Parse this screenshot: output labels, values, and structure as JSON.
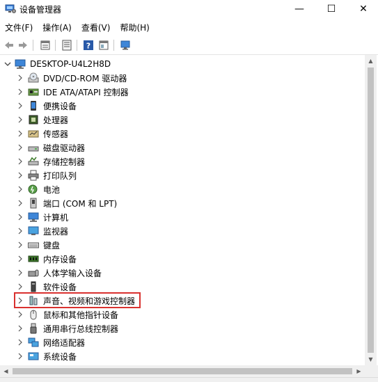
{
  "window": {
    "title": "设备管理器",
    "minimize_glyph": "—",
    "maximize_glyph": "☐",
    "close_glyph": "✕"
  },
  "menu": [
    {
      "label": "文件(F)"
    },
    {
      "label": "操作(A)"
    },
    {
      "label": "查看(V)"
    },
    {
      "label": "帮助(H)"
    }
  ],
  "toolbar": {
    "buttons": [
      "back-arrow-icon",
      "forward-arrow-icon",
      "properties-icon",
      "device-list-icon",
      "help-icon",
      "update-driver-icon",
      "monitor-scan-icon"
    ]
  },
  "tree": {
    "root": {
      "label": "DESKTOP-U4L2H8D",
      "icon": "computer-icon",
      "expanded": true
    },
    "items": [
      {
        "label": "DVD/CD-ROM 驱动器",
        "icon": "dvd-drive-icon"
      },
      {
        "label": "IDE ATA/ATAPI 控制器",
        "icon": "ide-controller-icon"
      },
      {
        "label": "便携设备",
        "icon": "portable-device-icon"
      },
      {
        "label": "处理器",
        "icon": "processor-icon"
      },
      {
        "label": "传感器",
        "icon": "sensor-icon"
      },
      {
        "label": "磁盘驱动器",
        "icon": "disk-drive-icon"
      },
      {
        "label": "存储控制器",
        "icon": "storage-controller-icon"
      },
      {
        "label": "打印队列",
        "icon": "printer-icon"
      },
      {
        "label": "电池",
        "icon": "battery-icon"
      },
      {
        "label": "端口 (COM 和 LPT)",
        "icon": "port-icon"
      },
      {
        "label": "计算机",
        "icon": "computer-icon"
      },
      {
        "label": "监视器",
        "icon": "monitor-icon"
      },
      {
        "label": "键盘",
        "icon": "keyboard-icon"
      },
      {
        "label": "内存设备",
        "icon": "memory-icon"
      },
      {
        "label": "人体学输入设备",
        "icon": "hid-icon"
      },
      {
        "label": "软件设备",
        "icon": "software-device-icon"
      },
      {
        "label": "声音、视频和游戏控制器",
        "icon": "sound-icon"
      },
      {
        "label": "鼠标和其他指针设备",
        "icon": "mouse-icon"
      },
      {
        "label": "通用串行总线控制器",
        "icon": "usb-icon"
      },
      {
        "label": "网络适配器",
        "icon": "network-adapter-icon"
      },
      {
        "label": "系统设备",
        "icon": "system-device-icon"
      }
    ]
  },
  "highlight": {
    "color": "#d9312f"
  }
}
